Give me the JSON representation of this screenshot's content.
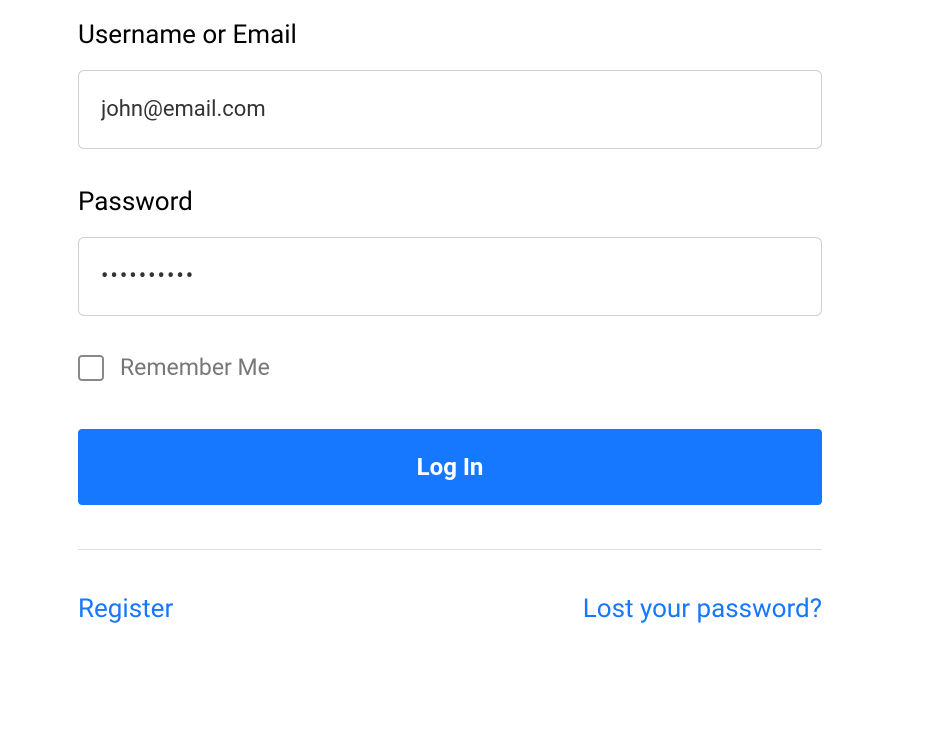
{
  "form": {
    "username": {
      "label": "Username or Email",
      "value": "john@email.com"
    },
    "password": {
      "label": "Password",
      "value": "••••••••••"
    },
    "remember": {
      "label": "Remember Me",
      "checked": false
    },
    "submit": {
      "label": "Log In"
    }
  },
  "links": {
    "register": "Register",
    "lost_password": "Lost your password?"
  },
  "colors": {
    "accent": "#1677ff"
  }
}
